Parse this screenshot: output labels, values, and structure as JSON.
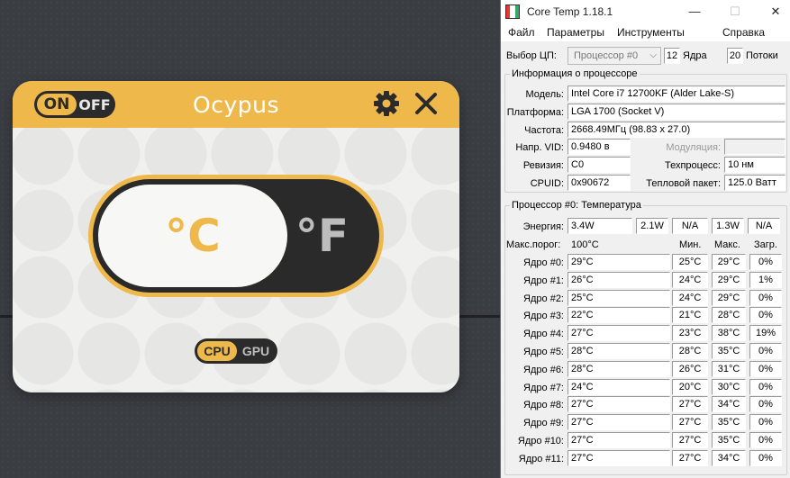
{
  "ocypus": {
    "power_on": "ON",
    "power_off": "OFF",
    "brand": "Ocypus",
    "unit_c": "°C",
    "unit_f": "°F",
    "device_cpu": "CPU",
    "device_gpu": "GPU",
    "accent_color": "#efb84a"
  },
  "coretemp": {
    "title": "Core Temp 1.18.1",
    "window_buttons": {
      "minimize": "—",
      "maximize": "☐",
      "close": "✕"
    },
    "menu": [
      "Файл",
      "Параметры",
      "Инструменты",
      "Справка"
    ],
    "cpu_select": {
      "label": "Выбор ЦП:",
      "value": "Процессор #0",
      "cores": "12",
      "cores_label": "Ядра",
      "threads": "20",
      "threads_label": "Потоки"
    },
    "info": {
      "group_title": "Информация о процессоре",
      "model_label": "Модель:",
      "model": "Intel Core i7 12700KF (Alder Lake-S)",
      "platform_label": "Платформа:",
      "platform": "LGA 1700 (Socket V)",
      "freq_label": "Частота:",
      "freq": "2668.49МГц (98.83 x 27.0)",
      "vid_label": "Напр. VID:",
      "vid": "0.9480 в",
      "modulation_label": "Модуляция:",
      "modulation": "",
      "revision_label": "Ревизия:",
      "revision": "C0",
      "lithography_label": "Техпроцесс:",
      "lithography": "10 нм",
      "cpuid_label": "CPUID:",
      "cpuid": "0x90672",
      "tdp_label": "Тепловой пакет:",
      "tdp": "125.0 Ватт"
    },
    "temps": {
      "group_title": "Процессор #0: Температура",
      "power_label": "Энергия:",
      "power": [
        "3.4W",
        "2.1W",
        "N/A",
        "1.3W",
        "N/A"
      ],
      "tjmax_label": "Макс.порог:",
      "tjmax": "100°C",
      "col_min": "Мин.",
      "col_max": "Макс.",
      "col_load": "Загр.",
      "cores": [
        {
          "name": "Ядро #0:",
          "temp": "29°C",
          "min": "25°C",
          "max": "29°C",
          "load": "0%"
        },
        {
          "name": "Ядро #1:",
          "temp": "26°C",
          "min": "24°C",
          "max": "29°C",
          "load": "1%"
        },
        {
          "name": "Ядро #2:",
          "temp": "25°C",
          "min": "24°C",
          "max": "29°C",
          "load": "0%"
        },
        {
          "name": "Ядро #3:",
          "temp": "22°C",
          "min": "21°C",
          "max": "28°C",
          "load": "0%"
        },
        {
          "name": "Ядро #4:",
          "temp": "27°C",
          "min": "23°C",
          "max": "38°C",
          "load": "19%"
        },
        {
          "name": "Ядро #5:",
          "temp": "28°C",
          "min": "28°C",
          "max": "35°C",
          "load": "0%"
        },
        {
          "name": "Ядро #6:",
          "temp": "28°C",
          "min": "26°C",
          "max": "31°C",
          "load": "0%"
        },
        {
          "name": "Ядро #7:",
          "temp": "24°C",
          "min": "20°C",
          "max": "30°C",
          "load": "0%"
        },
        {
          "name": "Ядро #8:",
          "temp": "27°C",
          "min": "27°C",
          "max": "34°C",
          "load": "0%"
        },
        {
          "name": "Ядро #9:",
          "temp": "27°C",
          "min": "27°C",
          "max": "35°C",
          "load": "0%"
        },
        {
          "name": "Ядро #10:",
          "temp": "27°C",
          "min": "27°C",
          "max": "35°C",
          "load": "0%"
        },
        {
          "name": "Ядро #11:",
          "temp": "27°C",
          "min": "27°C",
          "max": "34°C",
          "load": "0%"
        }
      ]
    }
  }
}
